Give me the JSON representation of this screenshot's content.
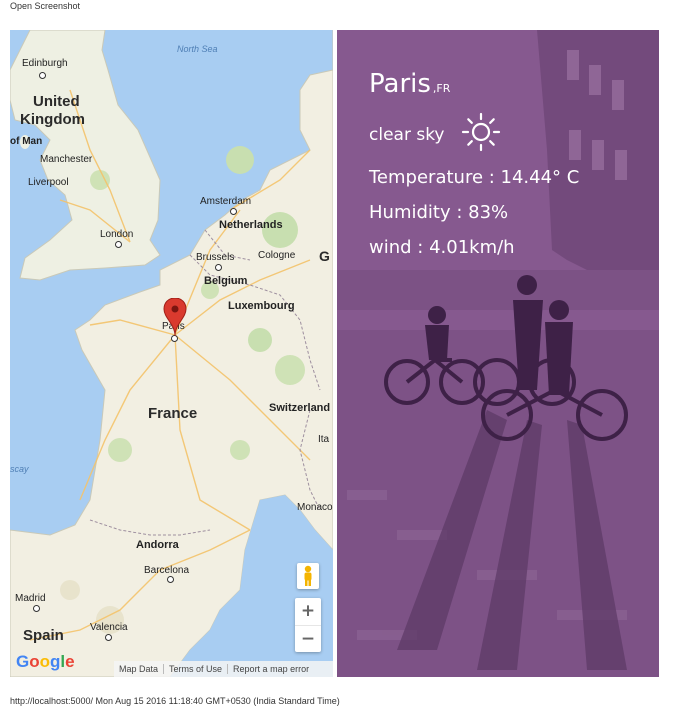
{
  "header": {
    "title": "Open Screenshot"
  },
  "map": {
    "labels": {
      "north_sea": "North Sea",
      "edinburgh": "Edinburgh",
      "united": "United",
      "kingdom": "Kingdom",
      "isle_of_man": "of Man",
      "manchester": "Manchester",
      "liverpool": "Liverpool",
      "amsterdam": "Amsterdam",
      "netherlands": "Netherlands",
      "london": "London",
      "brussels": "Brussels",
      "cologne": "Cologne",
      "belgium": "Belgium",
      "luxembourg": "Luxembourg",
      "paris": "Paris",
      "france": "France",
      "switzerland": "Switzerland",
      "italy_fragment": "Ita",
      "bay_fragment": "scay",
      "monaco": "Monaco",
      "andorra": "Andorra",
      "barcelona": "Barcelona",
      "madrid": "Madrid",
      "valencia": "Valencia",
      "spain": "Spain",
      "g_fragment": "G"
    },
    "zoom_in": "+",
    "zoom_out": "−",
    "logo": [
      "G",
      "o",
      "o",
      "g",
      "l",
      "e"
    ],
    "logo_colors": [
      "#4285F4",
      "#EA4335",
      "#FBBC05",
      "#4285F4",
      "#34A853",
      "#EA4335"
    ],
    "footer": {
      "map_data": "Map Data",
      "terms": "Terms of Use",
      "report": "Report a map error"
    },
    "marker_color": "#d93a2e"
  },
  "weather": {
    "city": "Paris",
    "country": ",FR",
    "description": "clear sky",
    "icon": "sun-icon",
    "temperature": "Temperature : 14.44° C",
    "humidity": "Humidity : 83%",
    "wind": "wind : 4.01km/h",
    "overlay_color": "#86598f"
  },
  "footer": {
    "status": "http://localhost:5000/ Mon Aug 15 2016 11:18:40 GMT+0530 (India Standard Time)"
  }
}
